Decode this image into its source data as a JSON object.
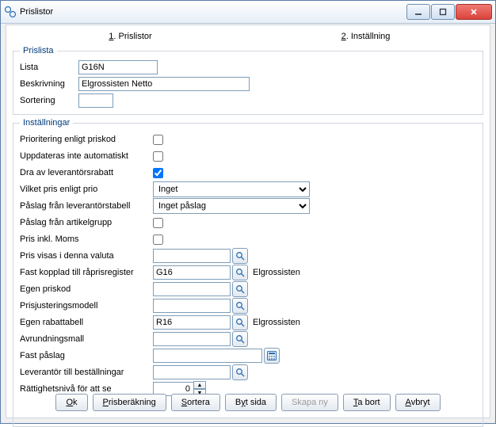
{
  "window": {
    "title": "Prislistor"
  },
  "pages": {
    "p1_prefix": "1",
    "p1_label": ". Prislistor",
    "p2_prefix": "2",
    "p2_label": ". Inställning"
  },
  "group_prislista": {
    "legend": "Prislista",
    "lista_label": "Lista",
    "lista_value": "G16N",
    "beskrivning_label": "Beskrivning",
    "beskrivning_value": "Elgrossisten Netto",
    "sortering_label": "Sortering",
    "sortering_value": ""
  },
  "group_inst": {
    "legend": "Inställningar",
    "prioritering_label": "Prioritering enligt priskod",
    "uppdateras_label": "Uppdateras inte automatiskt",
    "dra_label": "Dra av leverantörsrabatt",
    "vilket_label": "Vilket pris enligt prio",
    "vilket_value": "Inget",
    "paslag_lev_label": "Påslag från leverantörstabell",
    "paslag_lev_value": "Inget påslag",
    "paslag_art_label": "Påslag från artikelgrupp",
    "pris_moms_label": "Pris inkl. Moms",
    "pris_valuta_label": "Pris visas i denna valuta",
    "pris_valuta_value": "",
    "fast_kopplad_label": "Fast kopplad till råprisregister",
    "fast_kopplad_value": "G16",
    "fast_kopplad_after": "Elgrossisten",
    "egen_priskod_label": "Egen priskod",
    "egen_priskod_value": "",
    "prisjust_label": "Prisjusteringsmodell",
    "prisjust_value": "",
    "egen_rabatt_label": "Egen rabattabell",
    "egen_rabatt_value": "R16",
    "egen_rabatt_after": "Elgrossisten",
    "avrundning_label": "Avrundningsmall",
    "avrundning_value": "",
    "fast_paslag_label": "Fast påslag",
    "fast_paslag_value": "",
    "leverantor_label": "Leverantör till beställningar",
    "leverantor_value": "",
    "rattighet_label": "Rättighetsnivå för att se",
    "rattighet_value": "0"
  },
  "buttons": {
    "ok_u": "O",
    "ok_rest": "k",
    "prisb_u": "P",
    "prisb_rest": "risberäkning",
    "sortera_u": "S",
    "sortera_rest": "ortera",
    "byt_pre": "B",
    "byt_u": "y",
    "byt_post": "t sida",
    "skapa": "Skapa ny",
    "tabort_u": "T",
    "tabort_rest": "a bort",
    "avbryt_u": "A",
    "avbryt_rest": "vbryt"
  }
}
